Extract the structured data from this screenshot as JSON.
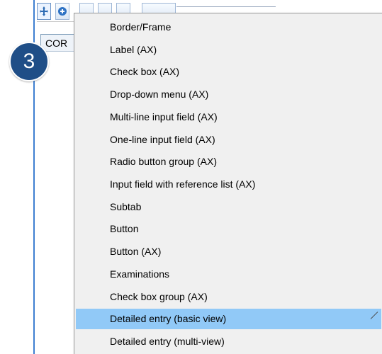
{
  "tab": {
    "label": "COR"
  },
  "step_badge": {
    "number": "3"
  },
  "colors": {
    "menu_background": "#f0f0f0",
    "selected_background": "#91c9f7",
    "badge_background": "#1f4e87",
    "frame_accent": "#3f7fd1"
  },
  "toolbar": {
    "icons": [
      "move-icon",
      "add-icon"
    ]
  },
  "menu": {
    "items": [
      {
        "label": "Border/Frame",
        "selected": false
      },
      {
        "label": "Label (AX)",
        "selected": false
      },
      {
        "label": "Check box (AX)",
        "selected": false
      },
      {
        "label": "Drop-down menu (AX)",
        "selected": false
      },
      {
        "label": "Multi-line input field (AX)",
        "selected": false
      },
      {
        "label": "One-line input field (AX)",
        "selected": false
      },
      {
        "label": "Radio button group (AX)",
        "selected": false
      },
      {
        "label": "Input field with reference list (AX)",
        "selected": false
      },
      {
        "label": "Subtab",
        "selected": false
      },
      {
        "label": "Button",
        "selected": false
      },
      {
        "label": "Button (AX)",
        "selected": false
      },
      {
        "label": "Examinations",
        "selected": false
      },
      {
        "label": "Check box group (AX)",
        "selected": false
      },
      {
        "label": "Detailed entry (basic view)",
        "selected": true
      },
      {
        "label": "Detailed entry (multi-view)",
        "selected": false
      }
    ]
  }
}
